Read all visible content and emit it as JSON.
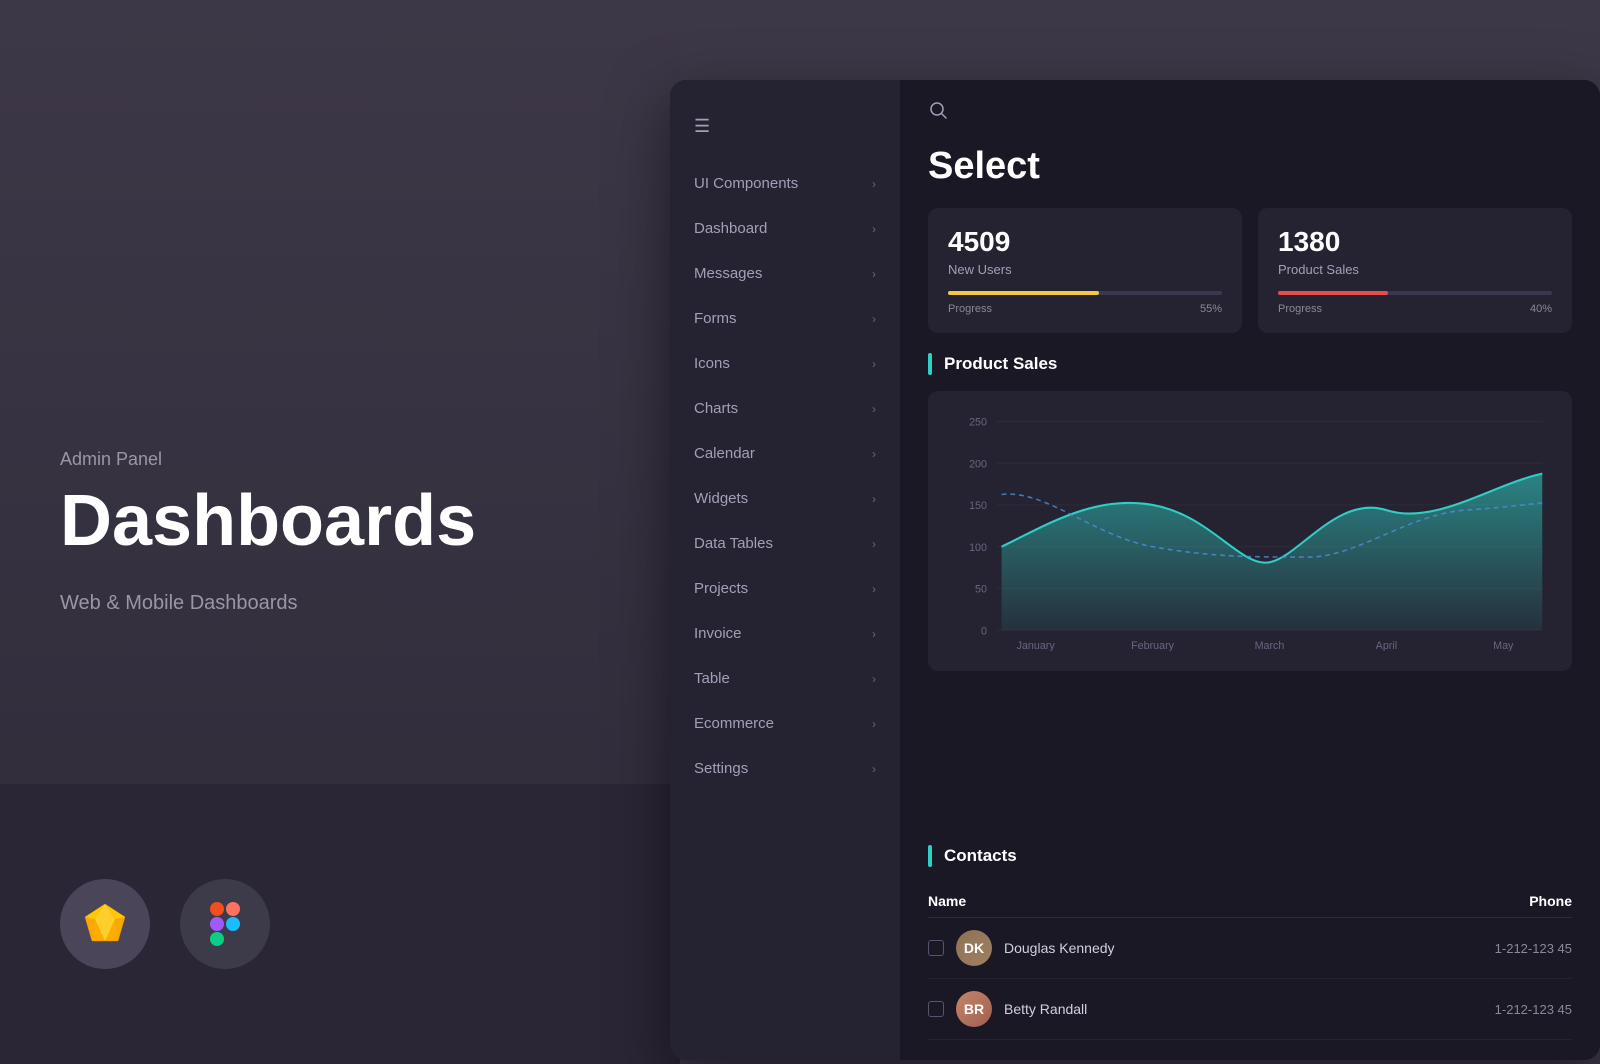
{
  "left": {
    "admin_label": "Admin Panel",
    "title": "Dashboards",
    "subtitle": "Web & Mobile Dashboards"
  },
  "header": {
    "page_title": "Select"
  },
  "sidebar": {
    "items": [
      {
        "label": "UI Components"
      },
      {
        "label": "Dashboard"
      },
      {
        "label": "Messages"
      },
      {
        "label": "Forms"
      },
      {
        "label": "Icons"
      },
      {
        "label": "Charts"
      },
      {
        "label": "Calendar"
      },
      {
        "label": "Widgets"
      },
      {
        "label": "Data Tables"
      },
      {
        "label": "Projects"
      },
      {
        "label": "Invoice"
      },
      {
        "label": "Table"
      },
      {
        "label": "Ecommerce"
      },
      {
        "label": "Settings"
      }
    ]
  },
  "stats": {
    "card1": {
      "number": "4509",
      "label": "New Users",
      "progress_label": "Progress",
      "progress_pct": "55%"
    },
    "card2": {
      "number": "1380",
      "label": "Product Sales",
      "progress_label": "Progress",
      "progress_pct": "40%"
    }
  },
  "chart": {
    "title": "Product Sales",
    "y_labels": [
      "250",
      "200",
      "150",
      "100",
      "50",
      "0"
    ],
    "x_labels": [
      "January",
      "February",
      "March",
      "April",
      "May"
    ]
  },
  "contacts": {
    "title": "Contacts",
    "col_name": "Name",
    "col_phone": "Phone",
    "rows": [
      {
        "name": "Douglas Kennedy",
        "phone": "1-212-123 45"
      },
      {
        "name": "Betty Randall",
        "phone": "1-212-123 45"
      }
    ]
  },
  "icons": {
    "hamburger": "☰",
    "search": "🔍",
    "chevron": "›"
  }
}
